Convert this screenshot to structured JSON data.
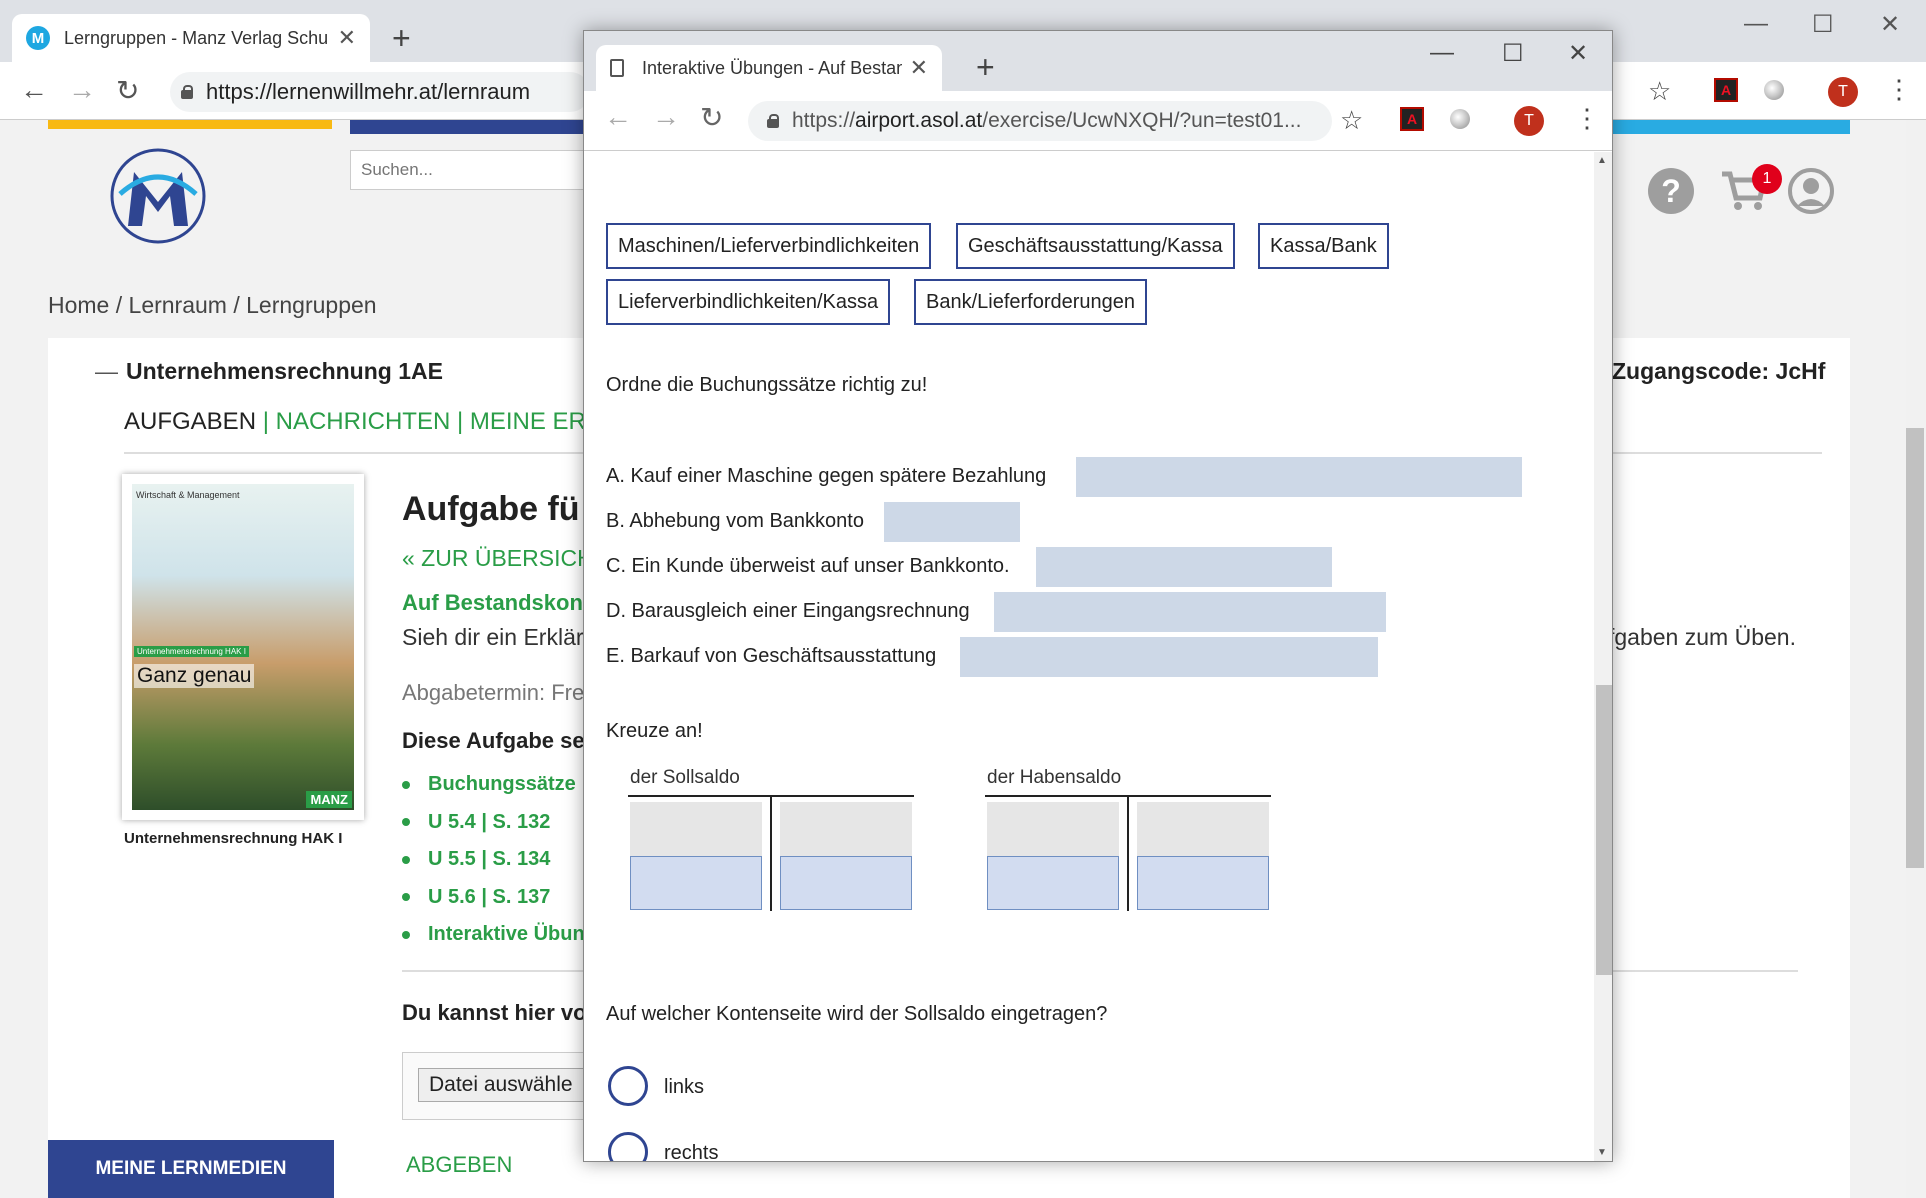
{
  "back_browser": {
    "tab_title": "Lerngruppen - Manz Verlag Schu",
    "tab_favicon": "M",
    "url": "https://lernenwillmehr.at/lernraum",
    "avatar_letter": "T"
  },
  "page": {
    "search_placeholder": "Suchen...",
    "breadcrumb": "Home / Lernraum / Lerngruppen",
    "cart_badge": "1",
    "group_toggle": "—",
    "group_title": "Unternehmensrechnung 1AE",
    "access_code": "Zugangscode: JcHf",
    "nav": {
      "active": "AUFGABEN",
      "sep": "|",
      "links": [
        "NACHRICHTEN",
        "MEINE ERGE"
      ]
    },
    "book": {
      "brand": "Wirtschaft & Management",
      "subtitle_band": "Unternehmensrechnung HAK I",
      "title": "Ganz genau",
      "publisher": "MANZ",
      "caption": "Unternehmensrechnung HAK I"
    },
    "task_title": "Aufgabe fü",
    "back_link": "« ZUR ÜBERSICH",
    "subheading": "Auf Bestandskon",
    "description_left": "Sieh dir ein Erklärv",
    "description_right": "fgaben zum Üben.",
    "deadline": "Abgabetermin: Fre",
    "section_heading": "Diese Aufgabe se",
    "items": [
      "Buchungssätze",
      "U 5.4 | S. 132",
      "U 5.5 | S. 134",
      "U 5.6 | S. 137",
      "Interaktive Übun"
    ],
    "upload_heading": "Du kannst hier vo",
    "file_button": "Datei auswähle",
    "lernmedien_button": "MEINE LERNMEDIEN",
    "submit_link": "ABGEBEN"
  },
  "popup": {
    "tab_title": "Interaktive Übungen - Auf Bestan",
    "url_prefix": "https://",
    "url_host": "airport.asol.at",
    "url_path": "/exercise/UcwNXQH/?un=test01...",
    "avatar_letter": "T",
    "chips_row1": [
      "Maschinen/Lieferverbindlichkeiten",
      "Geschäftsausstattung/Kassa",
      "Kassa/Bank"
    ],
    "chips_row2": [
      "Lieferverbindlichkeiten/Kassa",
      "Bank/Lieferforderungen"
    ],
    "instruction_match": "Ordne die Buchungssätze richtig zu!",
    "match_items": [
      "A. Kauf einer Maschine gegen spätere Bezahlung",
      "B. Abhebung vom Bankkonto",
      "C. Ein Kunde überweist auf unser Bankkonto.",
      "D. Barausgleich einer Eingangsrechnung",
      "E. Barkauf von Geschäftsausstattung"
    ],
    "instruction_cross": "Kreuze an!",
    "taccount_left_label": "der Sollsaldo",
    "taccount_right_label": "der Habensaldo",
    "question": "Auf welcher Kontenseite wird der Sollsaldo eingetragen?",
    "options": [
      "links",
      "rechts"
    ]
  }
}
